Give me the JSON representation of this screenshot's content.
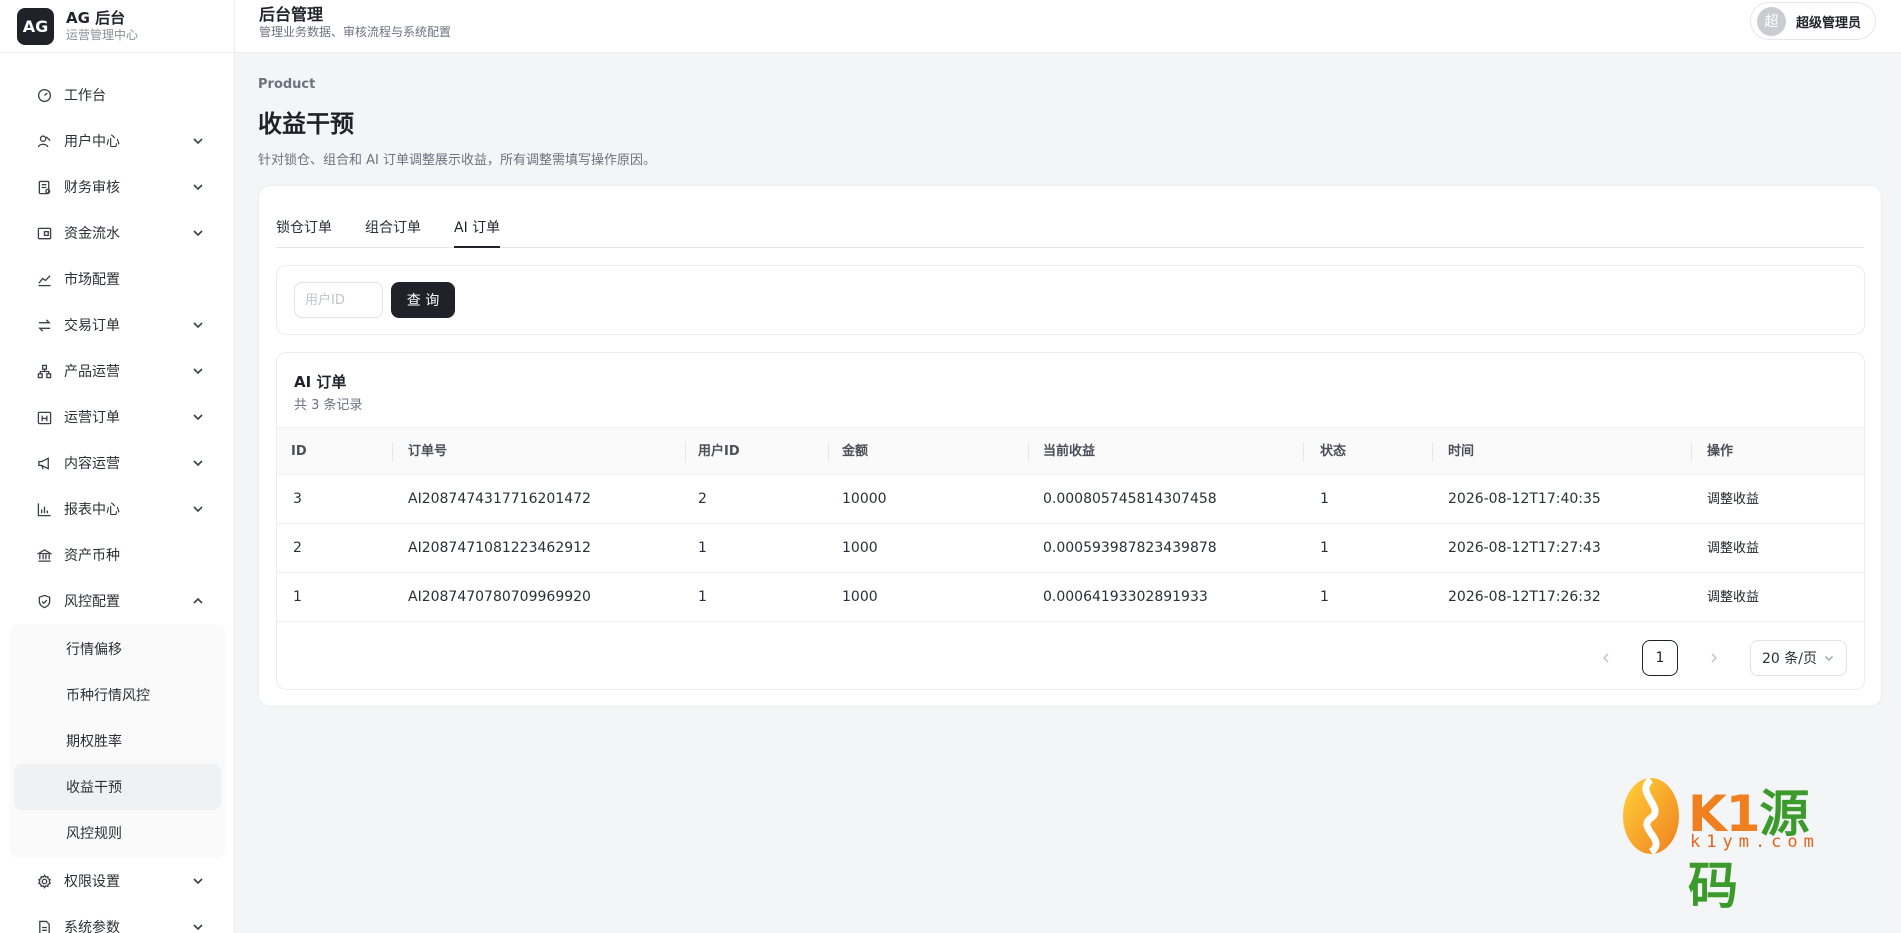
{
  "brand": {
    "logo": "AG",
    "title": "AG 后台",
    "subtitle": "运营管理中心"
  },
  "header": {
    "title": "后台管理",
    "subtitle": "管理业务数据、审核流程与系统配置"
  },
  "user": {
    "avatar": "超",
    "name": "超级管理员"
  },
  "sidebar": {
    "items": [
      {
        "label": "工作台",
        "icon": "dashboard-icon"
      },
      {
        "label": "用户中心",
        "icon": "user-icon"
      },
      {
        "label": "财务审核",
        "icon": "audit-icon"
      },
      {
        "label": "资金流水",
        "icon": "wallet-icon"
      },
      {
        "label": "市场配置",
        "icon": "chart-line-icon"
      },
      {
        "label": "交易订单",
        "icon": "swap-icon"
      },
      {
        "label": "产品运营",
        "icon": "cluster-icon"
      },
      {
        "label": "运营订单",
        "icon": "calendar-icon"
      },
      {
        "label": "内容运营",
        "icon": "megaphone-icon"
      },
      {
        "label": "报表中心",
        "icon": "bar-chart-icon"
      },
      {
        "label": "资产币种",
        "icon": "bank-icon"
      },
      {
        "label": "风控配置",
        "icon": "shield-icon"
      }
    ],
    "risk_sub": [
      "行情偏移",
      "币种行情风控",
      "期权胜率",
      "收益干预",
      "风控规则"
    ],
    "bottom_items": [
      {
        "label": "权限设置",
        "icon": "gear-icon"
      },
      {
        "label": "系统参数",
        "icon": "file-icon"
      }
    ]
  },
  "page": {
    "crumb": "Product",
    "title": "收益干预",
    "description": "针对锁仓、组合和 AI 订单调整展示收益，所有调整需填写操作原因。"
  },
  "tabs": [
    "锁仓订单",
    "组合订单",
    "AI 订单"
  ],
  "filter": {
    "placeholder": "用户ID",
    "query_label": "查 询"
  },
  "table": {
    "title": "AI 订单",
    "count": "共 3 条记录",
    "columns": [
      "ID",
      "订单号",
      "用户ID",
      "金额",
      "当前收益",
      "状态",
      "时间",
      "操作"
    ],
    "rows": [
      [
        "3",
        "AI2087474317716201472",
        "2",
        "10000",
        "0.000805745814307458",
        "1",
        "2026-08-12T17:40:35",
        "调整收益"
      ],
      [
        "2",
        "AI2087471081223462912",
        "1",
        "1000",
        "0.000593987823439878",
        "1",
        "2026-08-12T17:27:43",
        "调整收益"
      ],
      [
        "1",
        "AI2087470780709969920",
        "1",
        "1000",
        "0.00064193302891933",
        "1",
        "2026-08-12T17:26:32",
        "调整收益"
      ]
    ]
  },
  "pagination": {
    "current": "1",
    "page_size": "20 条/页"
  },
  "watermark": {
    "text_a": "K1",
    "text_b": "源码",
    "url": "k1ym.com"
  }
}
